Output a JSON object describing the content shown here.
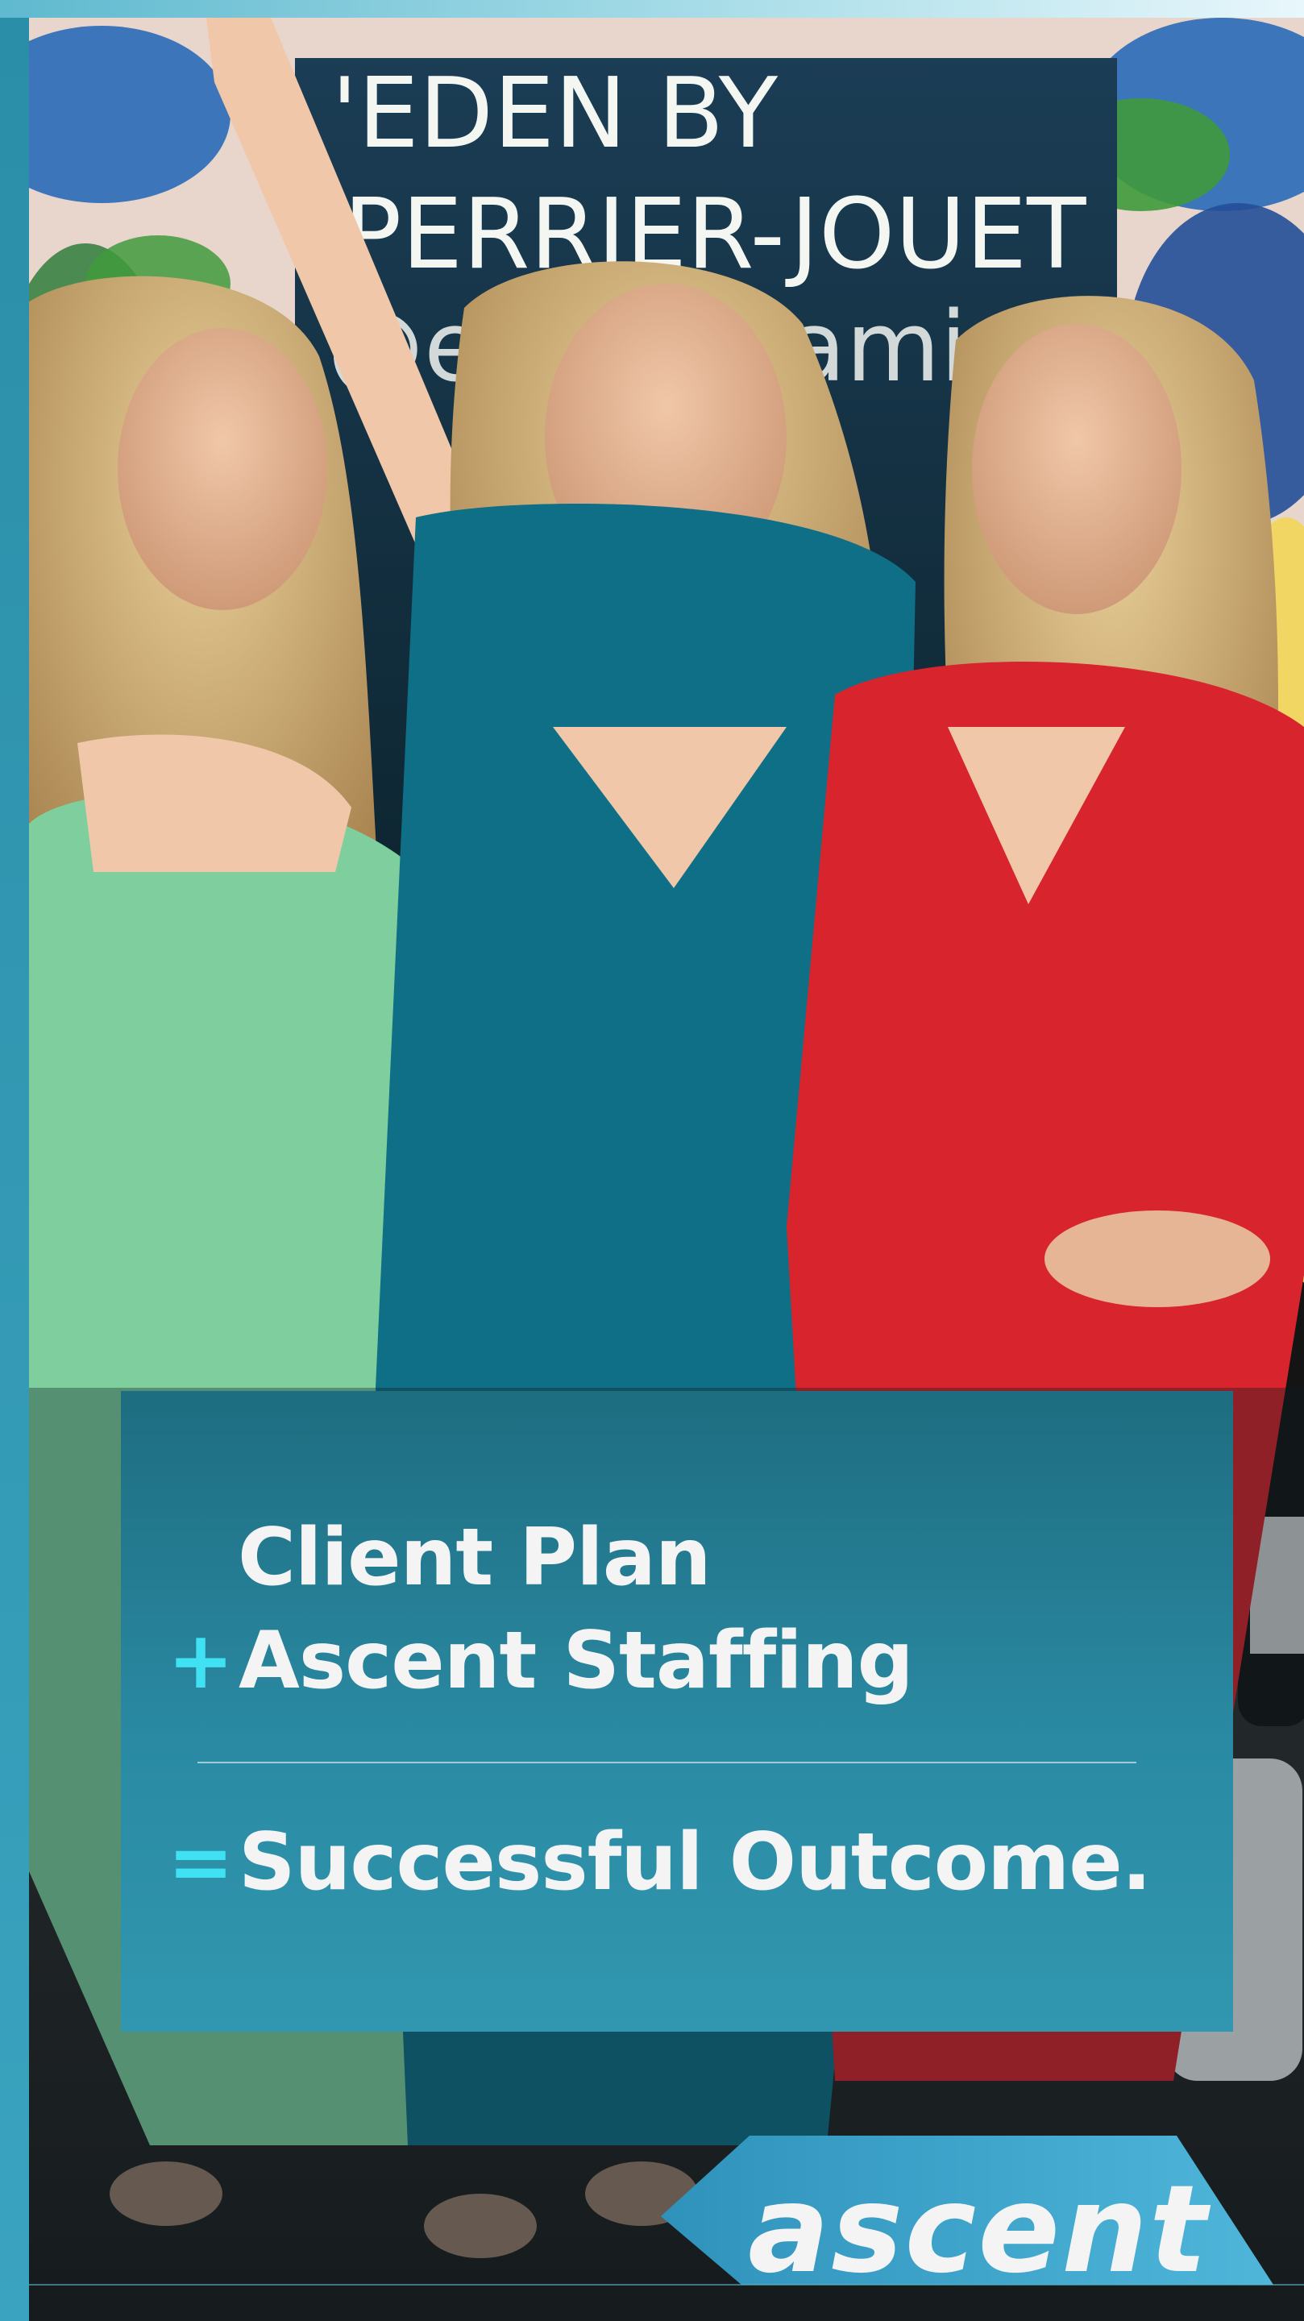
{
  "photo": {
    "sign_lines": [
      "'EDEN BY",
      "PERRIER-JOUET",
      "@edenmiami"
    ]
  },
  "panel": {
    "line1": {
      "operator": "",
      "text": "Client Plan"
    },
    "line2": {
      "operator": "+",
      "text": "Ascent Staffing"
    },
    "line3": {
      "operator": "=",
      "text": "Successful Outcome."
    }
  },
  "logo": {
    "text": "ascent"
  },
  "colors": {
    "accent": "#3fe1f2",
    "panel_top": "#1e6d80",
    "panel_bottom": "#3197b0",
    "logo_bg": "#3aa3c8",
    "dress_green": "#7fcf9e",
    "dress_teal": "#0f6f86",
    "dress_red": "#d8242c"
  }
}
